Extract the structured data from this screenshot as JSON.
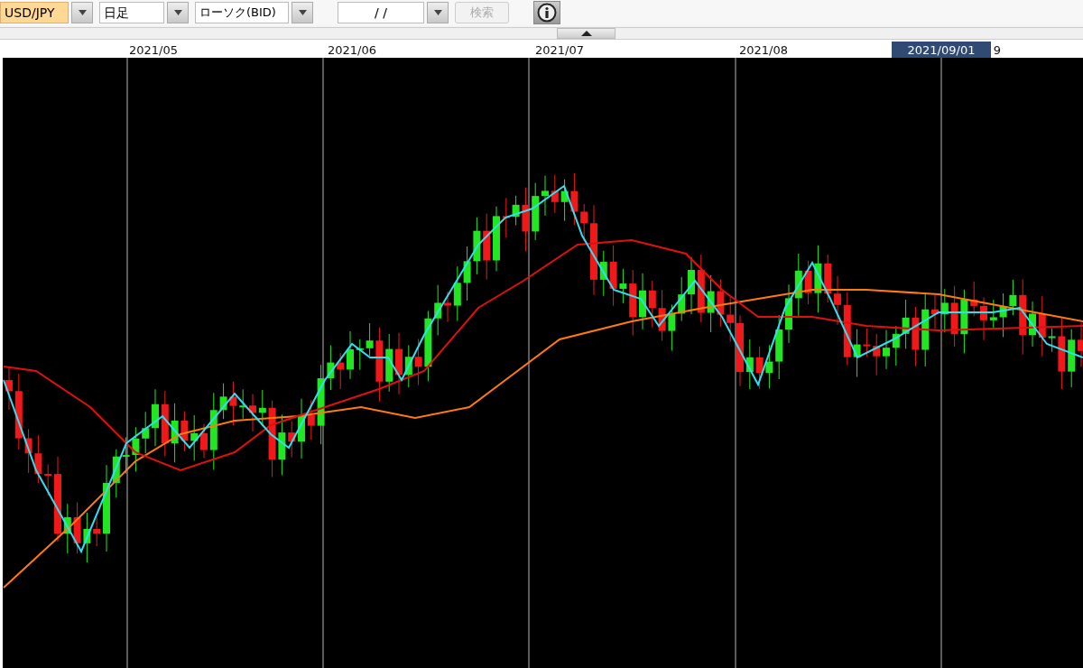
{
  "toolbar": {
    "pair": {
      "value": "USD/JPY"
    },
    "period": {
      "value": "日足"
    },
    "chart_type": {
      "value": "ローソク(BID)"
    },
    "date": {
      "value": "/  /"
    },
    "search_button": {
      "label": "検索",
      "disabled": true
    }
  },
  "time_axis": {
    "labels": [
      "2021/05",
      "2021/06",
      "2021/07",
      "2021/08",
      "9"
    ],
    "cursor_label": "2021/09/01"
  }
}
